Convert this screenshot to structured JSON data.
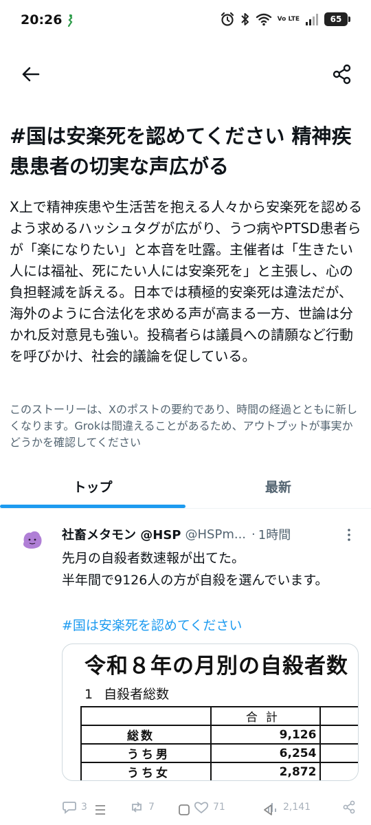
{
  "status_bar": {
    "time": "20:26",
    "network_label": "Vo LTE",
    "battery": "65"
  },
  "article": {
    "headline": "#国は安楽死を認めてください 精神疾患患者の切実な声広がる",
    "summary": "X上で精神疾患や生活苦を抱える人々から安楽死を認めるよう求めるハッシュタグが広がり、うつ病やPTSD患者らが「楽になりたい」と本音を吐露。主催者は「生きたい人には福祉、死にたい人には安楽死を」と主張し、心の負担軽減を訴える。日本では積極的安楽死は違法だが、海外のように合法化を求める声が高まる一方、世論は分かれ反対意見も強い。投稿者らは議員への請願など行動を呼びかけ、社会的議論を促している。",
    "disclaimer": "このストーリーは、Xのポストの要約であり、時間の経過とともに新しくなります。Grokは間違えることがあるため、アウトプットが事実かどうかを確認してください"
  },
  "tabs": [
    {
      "label": "トップ",
      "active": true
    },
    {
      "label": "最新",
      "active": false
    }
  ],
  "post": {
    "author_name": "社畜メタモン @HSP",
    "handle": "@HSPm...",
    "separator": "·",
    "time": "1時間",
    "text_line1": "先月の自殺者数速報が出てた。",
    "text_line2": "半年間で9126人の方が自殺を選んでいます。",
    "hashtag": "#国は安楽死を認めてください",
    "media": {
      "title": "令和８年の月別の自殺者数",
      "section_number": "1",
      "section_label": "自殺者総数",
      "header": "合計",
      "rows": [
        {
          "label": "総数",
          "value": "9,126"
        },
        {
          "label": "うち男",
          "value": "6,254"
        },
        {
          "label": "うち女",
          "value": "2,872"
        }
      ]
    },
    "actions": {
      "replies": "3",
      "reposts": "7",
      "likes": "71",
      "views": "2,141"
    }
  },
  "colors": {
    "accent": "#1d9bf0",
    "secondary_text": "#536471",
    "primary_text": "#0f1419"
  }
}
